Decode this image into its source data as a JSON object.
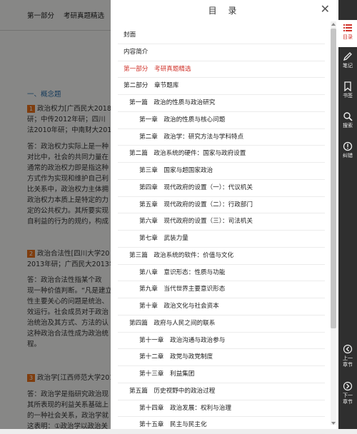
{
  "background": {
    "header": [
      "第一部分",
      "考研真题精选"
    ],
    "heading": "一、概念题",
    "items": [
      {
        "lines": [
          "政治权力[广西民大2018",
          "研；中传2012年研；四川",
          "法2010年研；中南财大2010"
        ],
        "badge": "1"
      },
      {
        "lines": [
          "答：政治权力实际上是一种",
          "对比中，社会的共同力量在",
          "通常的政治权力即是指这种",
          "方式作为实现和维护自己利",
          "比关系中，政治权力主体拥",
          "政治权力本质上是特定的力",
          "定的公共权力。其所要实现",
          "自利益的行为的规约，构成"
        ]
      },
      {
        "lines": [
          "政治合法性[四川大学20",
          "2013年研；广西民大2013年"
        ],
        "badge": "2"
      },
      {
        "lines": [
          "答：政治合法性指某个政",
          "现一种价值判断。“凡是建立",
          "性主要关心的问题是统治、",
          "效运行。社会成员对于政治",
          "治统治及其方式、方法的认",
          "这种政治合法性成为政治统",
          "程。"
        ]
      },
      {
        "lines": [
          "政治学[江西师范大学201"
        ],
        "badge": "3"
      },
      {
        "lines": [
          "答：政治学是指研究政治现",
          "其所表现的利益关系基础上",
          "的一种社会关系，政治学就",
          "这表明：①政治学以政治关"
        ]
      }
    ]
  },
  "toc": {
    "title": "目 录",
    "items": [
      {
        "text": "封面",
        "level": "top"
      },
      {
        "text": "内容简介",
        "level": "top"
      },
      {
        "text": "第一部分　考研真题精选",
        "level": "top",
        "active": true
      },
      {
        "text": "第二部分　章节题库",
        "level": "top"
      },
      {
        "text": "第一篇　政治的性质与政治研究",
        "level": "part"
      },
      {
        "text": "第一章　政治的性质与核心问题",
        "level": "chap"
      },
      {
        "text": "第二章　政治学：研究方法与学科特点",
        "level": "chap"
      },
      {
        "text": "第二篇　政治系统的硬件：国家与政府设置",
        "level": "part"
      },
      {
        "text": "第三章　国家与超国家政治",
        "level": "chap"
      },
      {
        "text": "第四章　现代政府的设置（一）：代议机关",
        "level": "chap"
      },
      {
        "text": "第五章　现代政府的设置（二）：行政部门",
        "level": "chap"
      },
      {
        "text": "第六章　现代政府的设置（三）：司法机关",
        "level": "chap"
      },
      {
        "text": "第七章　武装力量",
        "level": "chap"
      },
      {
        "text": "第三篇　政治系统的软件：价值与文化",
        "level": "part"
      },
      {
        "text": "第八章　意识形态：性质与功能",
        "level": "chap"
      },
      {
        "text": "第九章　当代世界主要意识形态",
        "level": "chap"
      },
      {
        "text": "第十章　政治文化与社会资本",
        "level": "chap"
      },
      {
        "text": "第四篇　政府与人民之间的联系",
        "level": "part"
      },
      {
        "text": "第十一章　政治沟通与政治参与",
        "level": "chap"
      },
      {
        "text": "第十二章　政党与政党制度",
        "level": "chap"
      },
      {
        "text": "第十三章　利益集团",
        "level": "chap"
      },
      {
        "text": "第五篇　历史视野中的政治过程",
        "level": "part"
      },
      {
        "text": "第十四章　政治发展：权利与治理",
        "level": "chap"
      },
      {
        "text": "第十五章　民主与民主化",
        "level": "chap"
      }
    ]
  },
  "toolbar": {
    "catalog": "目录",
    "notes": "笔记",
    "bookmark": "书签",
    "search": "搜索",
    "report": "纠错",
    "prev": [
      "上一",
      "章节"
    ],
    "next": [
      "下一",
      "章节"
    ]
  },
  "colors": {
    "accent": "#d0332b",
    "toolbar_bg": "#2f2f2f",
    "panel_bg": "#ffffff"
  }
}
